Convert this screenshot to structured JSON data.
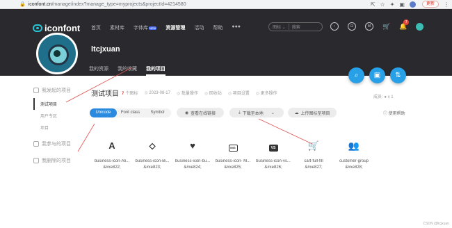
{
  "browser": {
    "url_host": "iconfont.cn",
    "url_path": "/manage/index?manage_type=myprojects&projectId=4214580",
    "update_label": "更新"
  },
  "header": {
    "logo_text": "iconfont",
    "nav": [
      "首页",
      "素材库",
      "字体库",
      "资源管理",
      "活动",
      "帮助",
      "●●●"
    ],
    "nav_badge": "NEW",
    "search_scope": "图标 ⌄",
    "search_placeholder": "搜索",
    "notification_count": "7",
    "username": "ltcjxuan",
    "subnav": [
      "我的资源",
      "我的收藏",
      "我的项目"
    ]
  },
  "sidebar": {
    "groups": [
      {
        "label": "我发起的项目",
        "items": [
          "测试项目",
          "用户专区",
          "项目"
        ]
      },
      {
        "label": "我参与的项目",
        "items": []
      },
      {
        "label": "我删除的项目",
        "items": []
      }
    ]
  },
  "project": {
    "title": "测试项目",
    "count": "7",
    "count_unit": "个图标",
    "date": "2023-08-17",
    "actions": [
      "批量操作",
      "回收站",
      "项目设置",
      "更多操作"
    ],
    "members": "成员: ● x 1"
  },
  "tabs": [
    "Unicode",
    "Font class",
    "Symbol"
  ],
  "buttons": {
    "view_online": "查看在线链接",
    "download": "下载至本地",
    "upload": "上传图标至项目",
    "help": "使用帮助"
  },
  "icons": [
    {
      "name": "business-icon-Ali...",
      "code": "&#xe822;",
      "glyph": "A"
    },
    {
      "name": "business-icon-Bi...",
      "code": "&#xe823;",
      "glyph": "⬦"
    },
    {
      "name": "business-icon-bu...",
      "code": "&#xe824;",
      "glyph": "♥"
    },
    {
      "name": "business-icon- M...",
      "code": "&#xe825;",
      "glyph": "IMG"
    },
    {
      "name": "business-icon-vs...",
      "code": "&#xe826;",
      "glyph": "VS"
    },
    {
      "name": "cart-full-fill",
      "code": "&#xe827;",
      "glyph": "🛒"
    },
    {
      "name": "customer-group",
      "code": "&#xe828;",
      "glyph": "👥"
    }
  ],
  "watermark": "CSDN @ltcjxuan",
  "colors": {
    "accent": "#2a8ae0",
    "header_bg": "#2a2a2e",
    "badge_red": "#e8453c"
  }
}
